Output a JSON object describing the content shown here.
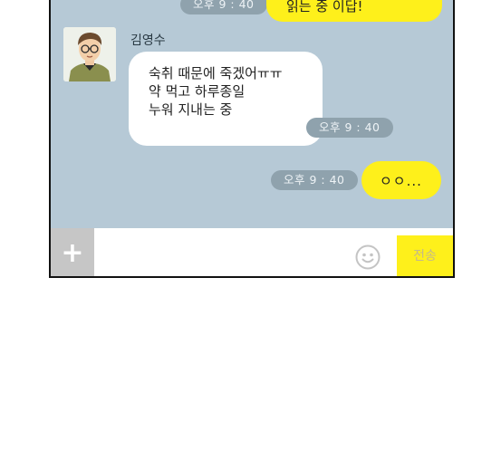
{
  "chat": {
    "partial_message": "읽는 중 이답!",
    "partial_time": "오후 9 : 40",
    "sender_name": "김영수",
    "incoming_lines": [
      "숙취 때문에 죽겠어ㅠㅠ",
      "약 먹고 하루종일",
      "누워 지내는 중"
    ],
    "incoming_time": "오후 9 : 40",
    "outgoing_message": "ㅇㅇ...",
    "outgoing_time": "오후 9 : 40"
  },
  "input": {
    "plus_label": "+",
    "send_label": "전송",
    "emoji_icon": "smiley-icon"
  },
  "colors": {
    "chat_bg": "#b6c9d6",
    "my_bubble": "#fef01b",
    "their_bubble": "#ffffff",
    "time_pill": "#8fa2ad"
  }
}
